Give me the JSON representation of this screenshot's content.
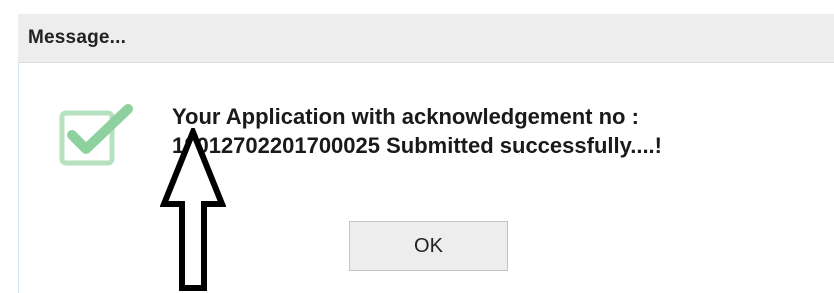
{
  "dialog": {
    "title": "Message...",
    "message_line1": "Your Application with acknowledgement no :",
    "message_line2": "12012702201700025 Submitted successfully....!",
    "ok_label": "OK",
    "icon": "check-icon",
    "annotation": "arrow-up-icon"
  },
  "colors": {
    "title_bar": "#ededed",
    "check_green": "#8fd19e",
    "check_box": "#b6e2bf",
    "button_bg": "#ededed"
  }
}
